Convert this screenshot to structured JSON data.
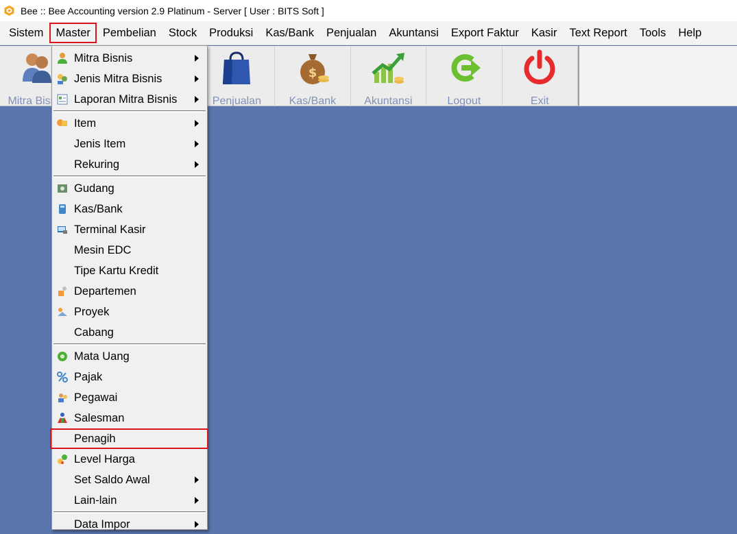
{
  "window": {
    "title": "Bee :: Bee Accounting version 2.9 Platinum - Server  [ User : BITS Soft ]",
    "app_icon": "bee-hexagon-icon"
  },
  "menubar": {
    "items": [
      {
        "label": "Sistem"
      },
      {
        "label": "Master"
      },
      {
        "label": "Pembelian"
      },
      {
        "label": "Stock"
      },
      {
        "label": "Produksi"
      },
      {
        "label": "Kas/Bank"
      },
      {
        "label": "Penjualan"
      },
      {
        "label": "Akuntansi"
      },
      {
        "label": "Export Faktur"
      },
      {
        "label": "Kasir"
      },
      {
        "label": "Text Report"
      },
      {
        "label": "Tools"
      },
      {
        "label": "Help"
      }
    ],
    "highlighted": "Master"
  },
  "toolbar": {
    "items": [
      {
        "label": "Mitra Bisnis",
        "icon": "business-partners-icon"
      },
      {
        "label": "Penjualan",
        "icon": "shopping-bag-icon"
      },
      {
        "label": "Kas/Bank",
        "icon": "money-bag-icon"
      },
      {
        "label": "Akuntansi",
        "icon": "growth-chart-icon"
      },
      {
        "label": "Logout",
        "icon": "logout-arrow-icon"
      },
      {
        "label": "Exit",
        "icon": "power-icon"
      }
    ]
  },
  "dropdown": {
    "groups": [
      [
        {
          "label": "Mitra Bisnis",
          "icon": "person-icon",
          "submenu": true
        },
        {
          "label": "Jenis Mitra Bisnis",
          "icon": "people-type-icon",
          "submenu": true
        },
        {
          "label": "Laporan Mitra Bisnis",
          "icon": "report-icon",
          "submenu": true
        }
      ],
      [
        {
          "label": "Item",
          "icon": "item-box-icon",
          "submenu": true
        },
        {
          "label": "Jenis Item",
          "icon": "",
          "submenu": true
        },
        {
          "label": "Rekuring",
          "icon": "",
          "submenu": true
        }
      ],
      [
        {
          "label": "Gudang",
          "icon": "warehouse-icon",
          "submenu": false
        },
        {
          "label": "Kas/Bank",
          "icon": "cash-register-icon",
          "submenu": false
        },
        {
          "label": "Terminal Kasir",
          "icon": "terminal-icon",
          "submenu": false
        },
        {
          "label": "Mesin EDC",
          "icon": "",
          "submenu": false
        },
        {
          "label": "Tipe Kartu Kredit",
          "icon": "",
          "submenu": false
        },
        {
          "label": "Departemen",
          "icon": "department-icon",
          "submenu": false
        },
        {
          "label": "Proyek",
          "icon": "project-icon",
          "submenu": false
        },
        {
          "label": "Cabang",
          "icon": "",
          "submenu": false
        }
      ],
      [
        {
          "label": "Mata Uang",
          "icon": "currency-coin-icon",
          "submenu": false
        },
        {
          "label": "Pajak",
          "icon": "percent-icon",
          "submenu": false
        },
        {
          "label": "Pegawai",
          "icon": "employee-icon",
          "submenu": false
        },
        {
          "label": "Salesman",
          "icon": "salesman-icon",
          "submenu": false
        },
        {
          "label": "Penagih",
          "icon": "",
          "submenu": false
        },
        {
          "label": "Level Harga",
          "icon": "price-level-icon",
          "submenu": false
        },
        {
          "label": "Set Saldo Awal",
          "icon": "",
          "submenu": true
        },
        {
          "label": "Lain-lain",
          "icon": "",
          "submenu": true
        }
      ],
      [
        {
          "label": "Data Impor",
          "icon": "",
          "submenu": true
        }
      ]
    ],
    "highlighted": "Penagih"
  },
  "colors": {
    "workspace": "#5a76ad",
    "highlight_box": "#d9141b",
    "toolbar_label": "#8090b8"
  }
}
